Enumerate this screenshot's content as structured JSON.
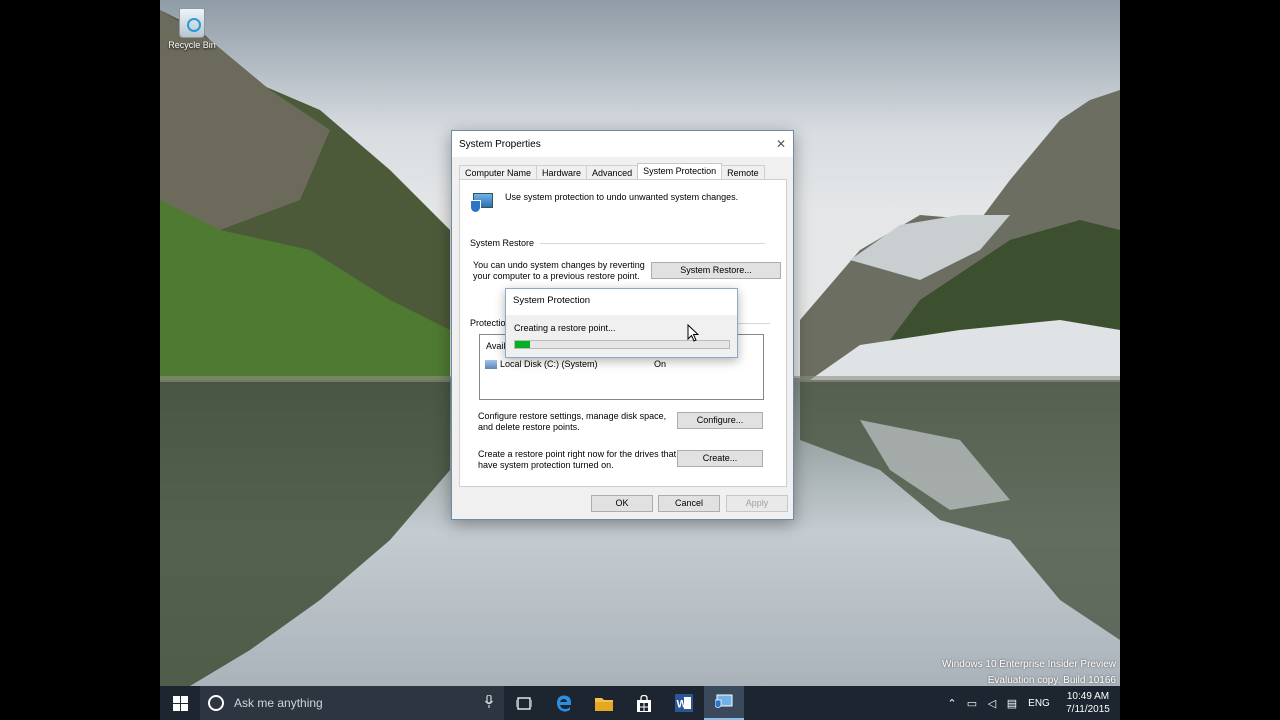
{
  "desktop": {
    "icons": [
      {
        "label": "Recycle Bin",
        "icon": "recycle-bin-icon"
      }
    ],
    "watermark": {
      "line1": "Windows 10 Enterprise Insider Preview",
      "line2": "Evaluation copy. Build 10166"
    }
  },
  "dialog": {
    "title": "System Properties",
    "close_label": "✕",
    "tabs": [
      {
        "label": "Computer Name",
        "selected": false
      },
      {
        "label": "Hardware",
        "selected": false
      },
      {
        "label": "Advanced",
        "selected": false
      },
      {
        "label": "System Protection",
        "selected": true
      },
      {
        "label": "Remote",
        "selected": false
      }
    ],
    "intro_text": "Use system protection to undo unwanted system changes.",
    "system_restore": {
      "group_label": "System Restore",
      "description_line1": "You can undo system changes by reverting",
      "description_line2": "your computer to a previous restore point.",
      "button_label": "System Restore..."
    },
    "protection_settings": {
      "group_label": "Protection",
      "table_header": "Avail",
      "rows": [
        {
          "drive": "Local Disk (C:) (System)",
          "status": "On"
        }
      ]
    },
    "configure": {
      "description_line1": "Configure restore settings, manage disk space,",
      "description_line2": "and delete restore points.",
      "button_label": "Configure..."
    },
    "create": {
      "description_line1": "Create a restore point right now for the drives that",
      "description_line2": "have system protection turned on.",
      "button_label": "Create..."
    },
    "footer": {
      "ok": "OK",
      "cancel": "Cancel",
      "apply": "Apply"
    }
  },
  "progress_popup": {
    "title": "System Protection",
    "status": "Creating a restore point...",
    "progress_percent": 7,
    "color": "#06b025"
  },
  "taskbar": {
    "search_placeholder": "Ask me anything",
    "apps": [
      {
        "name": "task-view-icon",
        "active": false
      },
      {
        "name": "edge-icon",
        "active": false
      },
      {
        "name": "file-explorer-icon",
        "active": false
      },
      {
        "name": "store-icon",
        "active": false
      },
      {
        "name": "word-icon",
        "active": false
      },
      {
        "name": "system-properties-icon",
        "active": true
      }
    ],
    "language": "ENG",
    "time": "10:49 AM",
    "date": "7/11/2015"
  },
  "colors": {
    "taskbar": "#1c2530",
    "accent": "#0078d7"
  }
}
